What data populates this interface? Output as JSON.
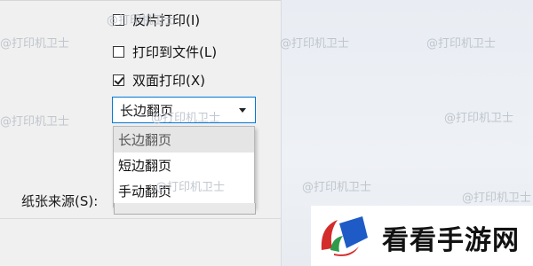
{
  "dialog": {
    "options": [
      {
        "label": "反片打印(I)",
        "checked": false
      },
      {
        "label": "打印到文件(L)",
        "checked": false
      },
      {
        "label": "双面打印(X)",
        "checked": true
      }
    ],
    "duplex_select": {
      "value": "长边翻页",
      "options": [
        "长边翻页",
        "短边翻页",
        "手动翻页"
      ],
      "highlighted_index": 0
    },
    "paper_source_label": "纸张来源(S):"
  },
  "watermark": {
    "text": "@打印机卫士"
  },
  "logo": {
    "text": "看看手游网"
  },
  "colors": {
    "focus_border": "#0078d7",
    "highlight": "#e5e5e5",
    "logo_red": "#d42b2b",
    "logo_blue": "#1e5bc6"
  }
}
